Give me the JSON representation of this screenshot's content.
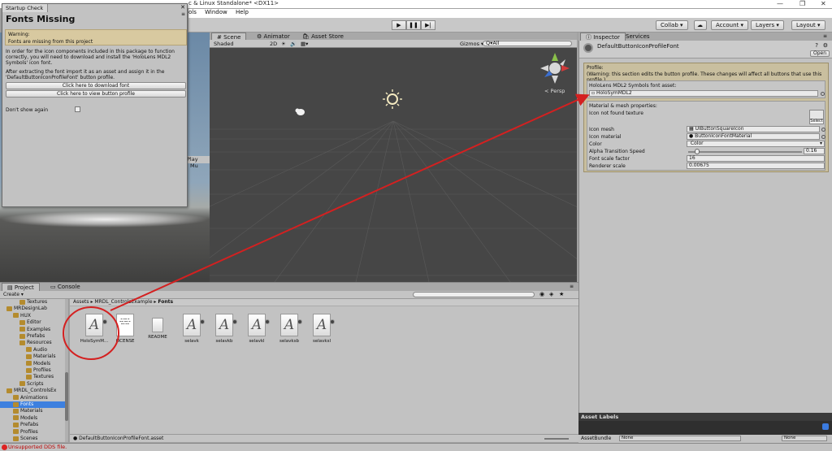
{
  "window": {
    "title": "c & Linux Standalone* <DX11>",
    "menu": [
      "ols",
      "Window",
      "Help"
    ]
  },
  "toolbar": {
    "collab": "Collab ▾",
    "account": "Account ▾",
    "layers": "Layers ▾",
    "layout": "Layout ▾"
  },
  "startup_check": {
    "tab": "Startup Check",
    "title": "Fonts Missing",
    "warning_label": "Warning:",
    "warning_text": "Fonts are missing from this project",
    "body_p1": "In order for the icon components included in this package to function correctly, you will need to download and install the 'HoloLens MDL2 Symbols' icon font.",
    "body_p2": "After extracting the font import it as an asset and assign it in the 'DefaultButtonIconProfileFont' button profile.",
    "btn_download": "Click here to download font",
    "btn_view": "Click here to view button profile",
    "dont_show": "Don't show again"
  },
  "game_view": {
    "tabs": [
      "Play",
      "Mu"
    ]
  },
  "scene": {
    "tabs": [
      "Scene",
      "Animator",
      "Asset Store"
    ],
    "shaded": "Shaded",
    "mode_2d": "2D",
    "gizmos": "Gizmos ▾",
    "search_placeholder": "Q▾All",
    "persp": "< Persp"
  },
  "inspector": {
    "tabs": [
      "Inspector",
      "Services"
    ],
    "object_name": "DefaultButtonIconProfileFont",
    "open_button": "Open",
    "profile_label": "Profile:",
    "profile_warning": "(Warning: this section edits the button profile. These changes will affect all buttons that use this profile.)",
    "font_asset_label": "HoloLens MDL2 Symbols font asset:",
    "font_asset_value": "HoloSymMDL2",
    "material_label": "Material & mesh properties:",
    "icon_not_found": "Icon not found texture",
    "select_button": "Select",
    "rows": [
      {
        "label": "Icon mesh",
        "value": "UIButtonSquareIcon"
      },
      {
        "label": "Icon material",
        "value": "ButtonIconFontMaterial"
      },
      {
        "label": "Color",
        "value": "Color"
      },
      {
        "label": "Alpha Transition Speed",
        "value": "0.16"
      },
      {
        "label": "Font scale factor",
        "value": "16"
      },
      {
        "label": "Renderer scale",
        "value": "0.00675"
      }
    ],
    "alpha_speed_level": 0.08
  },
  "project": {
    "tabs": [
      "Project",
      "Console"
    ],
    "create": "Create ▾",
    "breadcrumb": [
      "Assets",
      "MRDL_ControlsExample",
      "Fonts"
    ],
    "tree": [
      {
        "label": "Textures",
        "indent": 3,
        "sel": false
      },
      {
        "label": "MRDesignLab",
        "indent": 1,
        "sel": false
      },
      {
        "label": "HUX",
        "indent": 2,
        "sel": false
      },
      {
        "label": "Editor",
        "indent": 3,
        "sel": false
      },
      {
        "label": "Examples",
        "indent": 3,
        "sel": false
      },
      {
        "label": "Prefabs",
        "indent": 3,
        "sel": false
      },
      {
        "label": "Resources",
        "indent": 3,
        "sel": false
      },
      {
        "label": "Audio",
        "indent": 4,
        "sel": false
      },
      {
        "label": "Materials",
        "indent": 4,
        "sel": false
      },
      {
        "label": "Models",
        "indent": 4,
        "sel": false
      },
      {
        "label": "Profiles",
        "indent": 4,
        "sel": false
      },
      {
        "label": "Textures",
        "indent": 4,
        "sel": false
      },
      {
        "label": "Scripts",
        "indent": 3,
        "sel": false
      },
      {
        "label": "MRDL_ControlsEx",
        "indent": 1,
        "sel": false
      },
      {
        "label": "Animations",
        "indent": 2,
        "sel": false
      },
      {
        "label": "Fonts",
        "indent": 2,
        "sel": true
      },
      {
        "label": "Materials",
        "indent": 2,
        "sel": false
      },
      {
        "label": "Models",
        "indent": 2,
        "sel": false
      },
      {
        "label": "Prefabs",
        "indent": 2,
        "sel": false
      },
      {
        "label": "Profiles",
        "indent": 2,
        "sel": false
      },
      {
        "label": "Scenes",
        "indent": 2,
        "sel": false
      }
    ],
    "assets": [
      {
        "label": "HoloSymM...",
        "kind": "font"
      },
      {
        "label": "LICENSE",
        "kind": "text"
      },
      {
        "label": "README",
        "kind": "blank"
      },
      {
        "label": "selavk",
        "kind": "font"
      },
      {
        "label": "selavkb",
        "kind": "font"
      },
      {
        "label": "selavkl",
        "kind": "font"
      },
      {
        "label": "selavksb",
        "kind": "font"
      },
      {
        "label": "selavksl",
        "kind": "font"
      }
    ],
    "selected_path": "DefaultButtonIconProfileFont.asset"
  },
  "asset_labels": {
    "header": "Asset Labels",
    "bundle_label": "AssetBundle",
    "bundle_value": "None",
    "variant_value": "None"
  },
  "status": {
    "message": "Unsupported DDS file."
  },
  "colors": {
    "annotation": "#d42020",
    "selection": "#3d80df"
  }
}
